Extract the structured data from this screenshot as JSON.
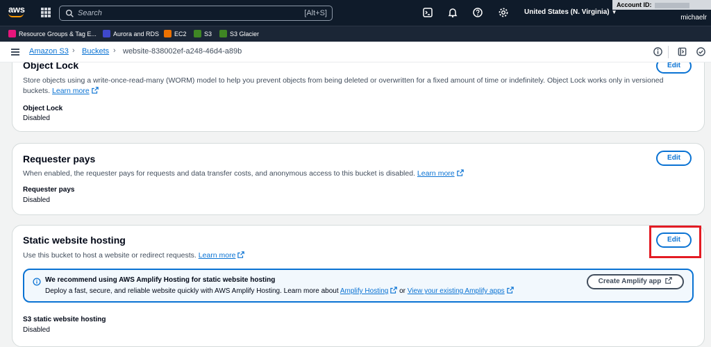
{
  "topnav": {
    "logo_text": "aws",
    "search_placeholder": "Search",
    "search_shortcut": "[Alt+S]",
    "region": "United States (N. Virginia)",
    "account_label": "Account ID:",
    "username": "michaelr"
  },
  "favorites": [
    {
      "label": "Resource Groups & Tag E...",
      "color": "#e7157b"
    },
    {
      "label": "Aurora and RDS",
      "color": "#3f48cc"
    },
    {
      "label": "EC2",
      "color": "#ed7100"
    },
    {
      "label": "S3",
      "color": "#3f8624"
    },
    {
      "label": "S3 Glacier",
      "color": "#3f8624"
    }
  ],
  "breadcrumb": {
    "items": [
      "Amazon S3",
      "Buckets",
      "website-838002ef-a248-46d4-a89b"
    ]
  },
  "object_lock": {
    "title": "Object Lock",
    "description": "Store objects using a write-once-read-many (WORM) model to help you prevent objects from being deleted or overwritten for a fixed amount of time or indefinitely. Object Lock works only in versioned",
    "description_2": "buckets.",
    "learn_more": "Learn more",
    "field_label": "Object Lock",
    "field_value": "Disabled",
    "edit_label": "Edit"
  },
  "requester_pays": {
    "title": "Requester pays",
    "description": "When enabled, the requester pays for requests and data transfer costs, and anonymous access to this bucket is disabled.",
    "learn_more": "Learn more",
    "field_label": "Requester pays",
    "field_value": "Disabled",
    "edit_label": "Edit"
  },
  "static_hosting": {
    "title": "Static website hosting",
    "description": "Use this bucket to host a website or redirect requests.",
    "learn_more": "Learn more",
    "edit_label": "Edit",
    "info_title": "We recommend using AWS Amplify Hosting for static website hosting",
    "info_text": "Deploy a fast, secure, and reliable website quickly with AWS Amplify Hosting. Learn more about",
    "amplify_link": "Amplify Hosting",
    "or_text": "or",
    "apps_link": "View your existing Amplify apps",
    "create_button": "Create Amplify app",
    "field_label": "S3 static website hosting",
    "field_value": "Disabled"
  },
  "colors": {
    "accent": "#0972d3",
    "nav_bg": "#0f1b2a",
    "highlight": "#e31b23"
  }
}
